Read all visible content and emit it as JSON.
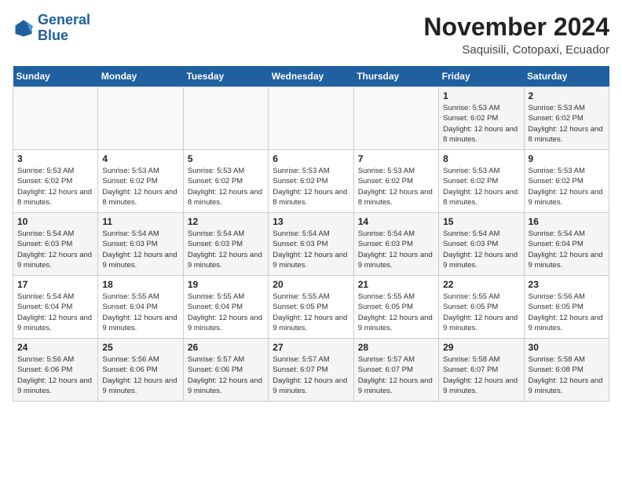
{
  "logo": {
    "line1": "General",
    "line2": "Blue"
  },
  "title": "November 2024",
  "location": "Saquisili, Cotopaxi, Ecuador",
  "days_of_week": [
    "Sunday",
    "Monday",
    "Tuesday",
    "Wednesday",
    "Thursday",
    "Friday",
    "Saturday"
  ],
  "weeks": [
    [
      {
        "day": "",
        "info": ""
      },
      {
        "day": "",
        "info": ""
      },
      {
        "day": "",
        "info": ""
      },
      {
        "day": "",
        "info": ""
      },
      {
        "day": "",
        "info": ""
      },
      {
        "day": "1",
        "info": "Sunrise: 5:53 AM\nSunset: 6:02 PM\nDaylight: 12 hours and 8 minutes."
      },
      {
        "day": "2",
        "info": "Sunrise: 5:53 AM\nSunset: 6:02 PM\nDaylight: 12 hours and 8 minutes."
      }
    ],
    [
      {
        "day": "3",
        "info": "Sunrise: 5:53 AM\nSunset: 6:02 PM\nDaylight: 12 hours and 8 minutes."
      },
      {
        "day": "4",
        "info": "Sunrise: 5:53 AM\nSunset: 6:02 PM\nDaylight: 12 hours and 8 minutes."
      },
      {
        "day": "5",
        "info": "Sunrise: 5:53 AM\nSunset: 6:02 PM\nDaylight: 12 hours and 8 minutes."
      },
      {
        "day": "6",
        "info": "Sunrise: 5:53 AM\nSunset: 6:02 PM\nDaylight: 12 hours and 8 minutes."
      },
      {
        "day": "7",
        "info": "Sunrise: 5:53 AM\nSunset: 6:02 PM\nDaylight: 12 hours and 8 minutes."
      },
      {
        "day": "8",
        "info": "Sunrise: 5:53 AM\nSunset: 6:02 PM\nDaylight: 12 hours and 8 minutes."
      },
      {
        "day": "9",
        "info": "Sunrise: 5:53 AM\nSunset: 6:02 PM\nDaylight: 12 hours and 9 minutes."
      }
    ],
    [
      {
        "day": "10",
        "info": "Sunrise: 5:54 AM\nSunset: 6:03 PM\nDaylight: 12 hours and 9 minutes."
      },
      {
        "day": "11",
        "info": "Sunrise: 5:54 AM\nSunset: 6:03 PM\nDaylight: 12 hours and 9 minutes."
      },
      {
        "day": "12",
        "info": "Sunrise: 5:54 AM\nSunset: 6:03 PM\nDaylight: 12 hours and 9 minutes."
      },
      {
        "day": "13",
        "info": "Sunrise: 5:54 AM\nSunset: 6:03 PM\nDaylight: 12 hours and 9 minutes."
      },
      {
        "day": "14",
        "info": "Sunrise: 5:54 AM\nSunset: 6:03 PM\nDaylight: 12 hours and 9 minutes."
      },
      {
        "day": "15",
        "info": "Sunrise: 5:54 AM\nSunset: 6:03 PM\nDaylight: 12 hours and 9 minutes."
      },
      {
        "day": "16",
        "info": "Sunrise: 5:54 AM\nSunset: 6:04 PM\nDaylight: 12 hours and 9 minutes."
      }
    ],
    [
      {
        "day": "17",
        "info": "Sunrise: 5:54 AM\nSunset: 6:04 PM\nDaylight: 12 hours and 9 minutes."
      },
      {
        "day": "18",
        "info": "Sunrise: 5:55 AM\nSunset: 6:04 PM\nDaylight: 12 hours and 9 minutes."
      },
      {
        "day": "19",
        "info": "Sunrise: 5:55 AM\nSunset: 6:04 PM\nDaylight: 12 hours and 9 minutes."
      },
      {
        "day": "20",
        "info": "Sunrise: 5:55 AM\nSunset: 6:05 PM\nDaylight: 12 hours and 9 minutes."
      },
      {
        "day": "21",
        "info": "Sunrise: 5:55 AM\nSunset: 6:05 PM\nDaylight: 12 hours and 9 minutes."
      },
      {
        "day": "22",
        "info": "Sunrise: 5:55 AM\nSunset: 6:05 PM\nDaylight: 12 hours and 9 minutes."
      },
      {
        "day": "23",
        "info": "Sunrise: 5:56 AM\nSunset: 6:05 PM\nDaylight: 12 hours and 9 minutes."
      }
    ],
    [
      {
        "day": "24",
        "info": "Sunrise: 5:56 AM\nSunset: 6:06 PM\nDaylight: 12 hours and 9 minutes."
      },
      {
        "day": "25",
        "info": "Sunrise: 5:56 AM\nSunset: 6:06 PM\nDaylight: 12 hours and 9 minutes."
      },
      {
        "day": "26",
        "info": "Sunrise: 5:57 AM\nSunset: 6:06 PM\nDaylight: 12 hours and 9 minutes."
      },
      {
        "day": "27",
        "info": "Sunrise: 5:57 AM\nSunset: 6:07 PM\nDaylight: 12 hours and 9 minutes."
      },
      {
        "day": "28",
        "info": "Sunrise: 5:57 AM\nSunset: 6:07 PM\nDaylight: 12 hours and 9 minutes."
      },
      {
        "day": "29",
        "info": "Sunrise: 5:58 AM\nSunset: 6:07 PM\nDaylight: 12 hours and 9 minutes."
      },
      {
        "day": "30",
        "info": "Sunrise: 5:58 AM\nSunset: 6:08 PM\nDaylight: 12 hours and 9 minutes."
      }
    ]
  ]
}
